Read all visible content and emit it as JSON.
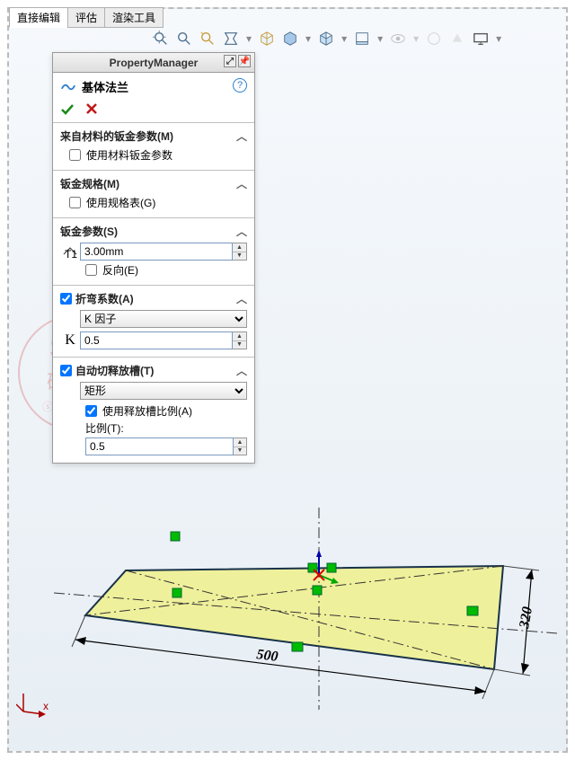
{
  "tabs": [
    "直接编辑",
    "评估",
    "渲染工具"
  ],
  "panel": {
    "title": "PropertyManager",
    "feature": "基体法兰",
    "sec1": {
      "title": "来自材料的钣金参数(M)",
      "chk": "使用材料钣金参数"
    },
    "sec2": {
      "title": "钣金规格(M)",
      "chk": "使用规格表(G)"
    },
    "sec3": {
      "title": "钣金参数(S)",
      "thickness": "3.00mm",
      "reverse": "反向(E)"
    },
    "sec4": {
      "title": "折弯系数(A)",
      "combo": "K 因子",
      "kval": "0.5"
    },
    "sec5": {
      "title": "自动切释放槽(T)",
      "combo": "矩形",
      "chk": "使用释放槽比例(A)",
      "ratiolbl": "比例(T):",
      "ratio": "0.5"
    }
  },
  "dims": {
    "w": "500",
    "h": "320"
  }
}
